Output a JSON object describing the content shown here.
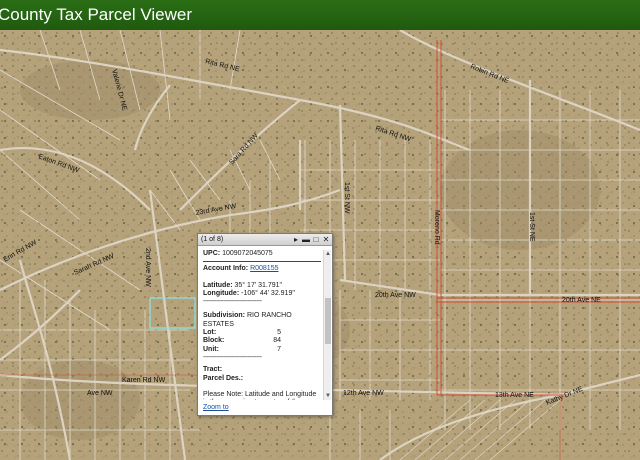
{
  "header": {
    "title": "County Tax Parcel Viewer"
  },
  "map": {
    "road_labels": [
      "Rita Rd NE",
      "Robin Rd NE",
      "Valerie Dr NE",
      "Rita Rd NW",
      "Sara Rd NW",
      "Eaton Rd NW",
      "Erin Rd NW",
      "Sarah Rd NW",
      "23rd Ave NW",
      "1st St NW",
      "Moreno Rd",
      "2nd Ave NW",
      "20th Ave NW",
      "20th Ave NE",
      "1st St NE",
      "12th Ave NW",
      "13th Ave NE",
      "Karen Rd NW",
      "Kathy Dr NE",
      "Ave NW"
    ]
  },
  "popup": {
    "counter": "(1 of 8)",
    "upc_label": "UPC:",
    "upc_value": "1009072045075",
    "account_label": "Account Info:",
    "account_value": "R008155",
    "latitude_label": "Latitude:",
    "latitude_value": "35° 17' 31.791\"",
    "longitude_label": "Longitude:",
    "longitude_value": "-106° 44' 32.919\"",
    "dashes": "--------------------------------",
    "subdivision_label": "Subdivision:",
    "subdivision_value": "RIO RANCHO ESTATES",
    "lot_label": "Lot:",
    "lot_value": "5",
    "block_label": "Block:",
    "block_value": "84",
    "unit_label": "Unit:",
    "unit_value": "7",
    "tract_label": "Tract:",
    "parcel_des_label": "Parcel Des.:",
    "note": "Please Note: Latitude and Longitude is the approximate center of the parcel shown.",
    "zoom_link": "Zoom to"
  },
  "colors": {
    "header_bg": "#2b6e16",
    "terrain": "#b6a27c",
    "parcel_lines": "#e8e4dc",
    "boundary_red": "#d2402c",
    "selected_parcel": "#8fe0e0",
    "link": "#1a4fa0"
  }
}
